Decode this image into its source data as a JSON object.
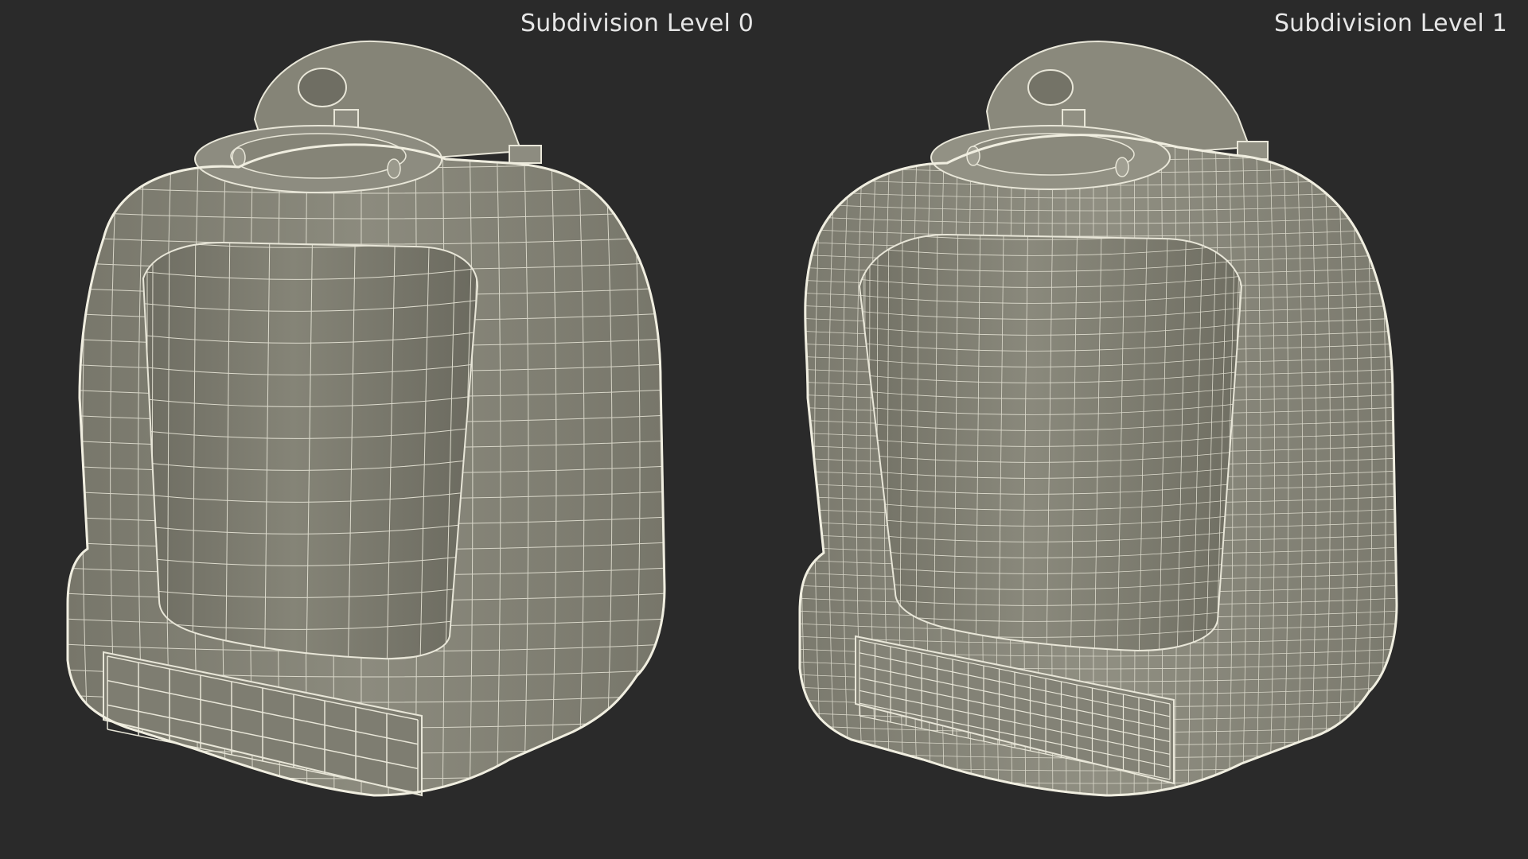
{
  "viewport": {
    "background": "#2a2a2a",
    "left_view": {
      "label": "Subdivision Level 0",
      "wire_density": 1,
      "surface_color": "#8a897b",
      "wire_color": "#e8e6d8"
    },
    "right_view": {
      "label": "Subdivision Level 1",
      "wire_density": 2,
      "surface_color": "#8a897b",
      "wire_color": "#e8e6d8"
    }
  }
}
